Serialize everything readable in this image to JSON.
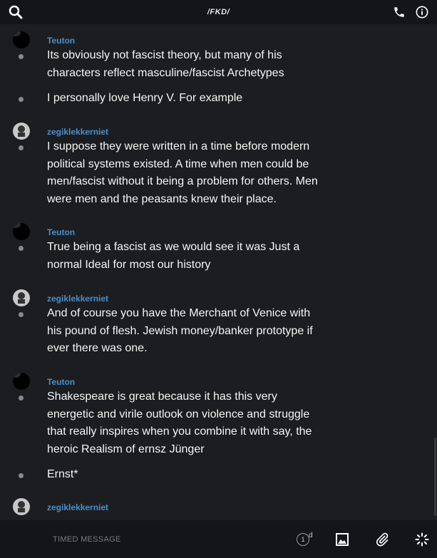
{
  "header": {
    "title": "/FKD/",
    "icons": [
      "search-icon",
      "phone-icon",
      "info-icon"
    ]
  },
  "messages": [
    {
      "author": "Teuton",
      "avatar": "dark",
      "lines": [
        "Its obviously not fascist theory, but many of his characters reflect masculine/fascist Archetypes",
        "I personally love Henry V. For example"
      ]
    },
    {
      "author": "zegiklekkerniet",
      "avatar": "gray",
      "lines": [
        "I suppose they were written in a time before modern political systems existed. A time when men could be men/fascist without it being a problem for others. Men were men and the peasants knew their place."
      ]
    },
    {
      "author": "Teuton",
      "avatar": "dark",
      "lines": [
        "True being a fascist as we would see it was Just a normal Ideal for most our history"
      ]
    },
    {
      "author": "zegiklekkerniet",
      "avatar": "gray",
      "lines": [
        "And of course you have the Merchant of Venice with his pound of flesh. Jewish money/banker prototype if ever there was one."
      ]
    },
    {
      "author": "Teuton",
      "avatar": "dark",
      "lines": [
        "Shakespeare is great because it has this very energetic and virile outlook on violence and struggle that really inspires when you combine it with say, the heroic Realism of ernsz Jünger",
        "Ernst*"
      ]
    },
    {
      "author": "zegiklekkerniet",
      "avatar": "gray",
      "lines": []
    }
  ],
  "composer": {
    "placeholder": "TIMED MESSAGE",
    "timer_value": "1",
    "timer_unit": "d",
    "icons": [
      "image-icon",
      "paperclip-icon",
      "loading-spinner-icon"
    ]
  }
}
